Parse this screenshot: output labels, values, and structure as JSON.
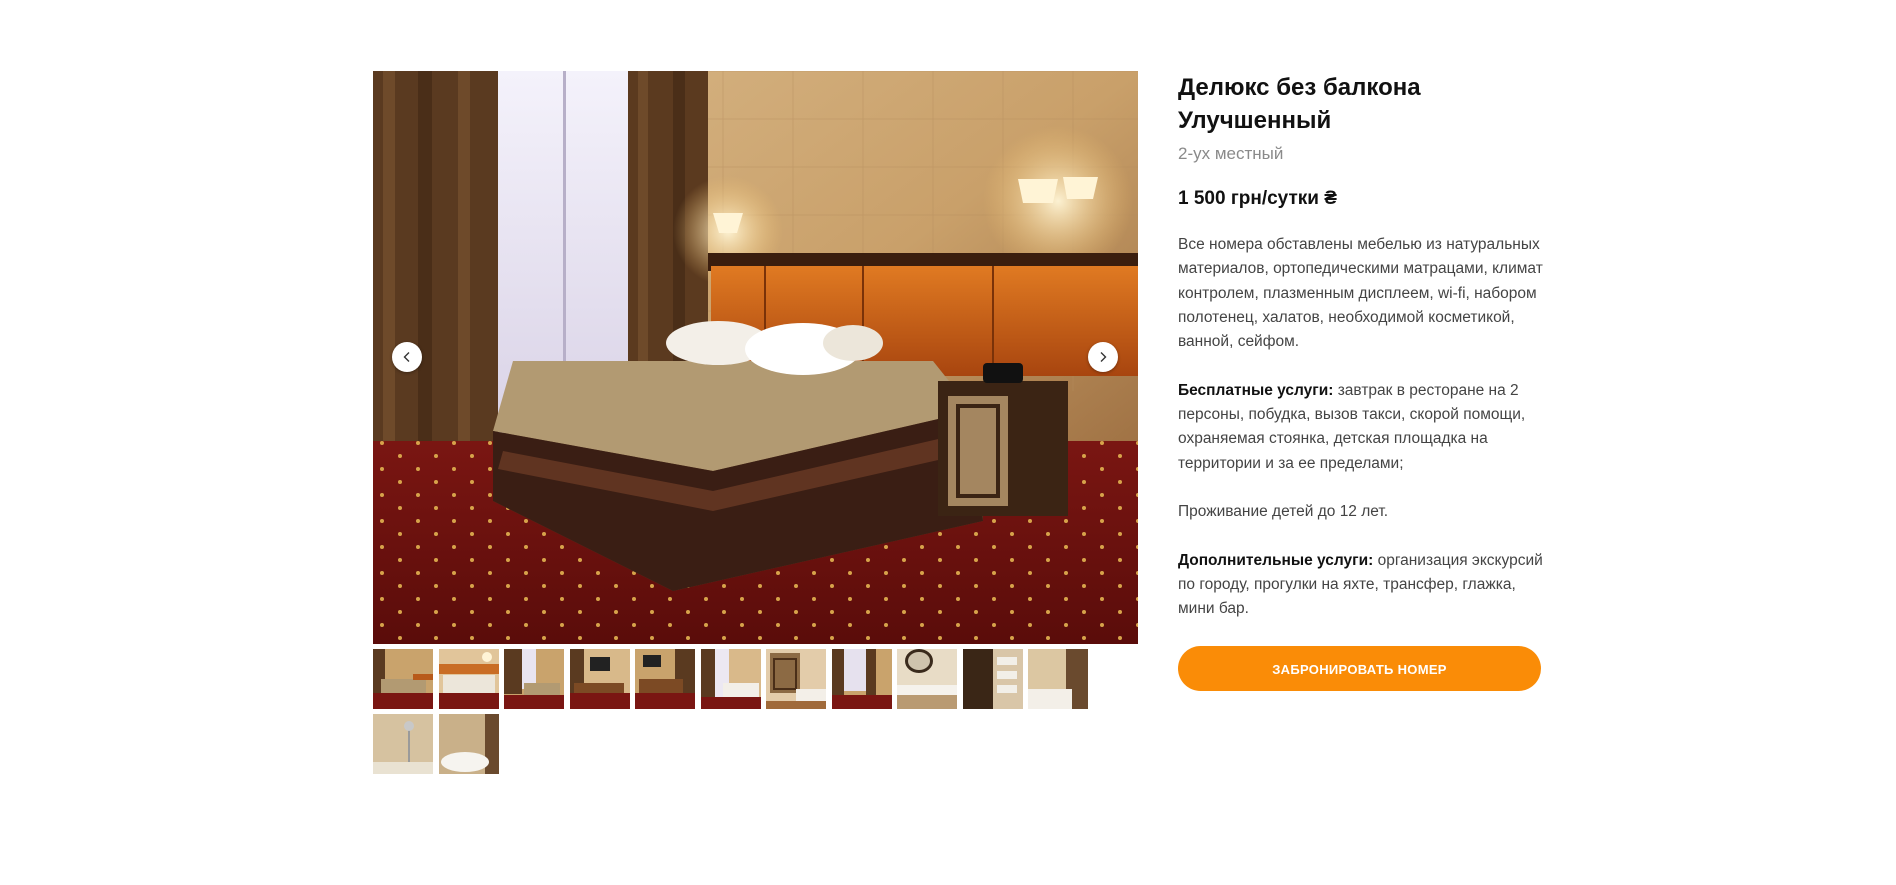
{
  "room": {
    "title_line1": "Делюкс без балкона",
    "title_line2": "Улучшенный",
    "capacity": "2-ух местный",
    "price": "1 500 грн/сутки ₴"
  },
  "description": {
    "amenities": "Все номера обставлены мебелью из натуральных материалов, ортопедическими матрацами, климат контролем, плазменным дисплеем, wi-fi, набором полотенец, халатов, необходимой косметикой, ванной, сейфом.",
    "free_label": "Бесплатные услуги:",
    "free_text": " завтрак в ресторане на 2 персоны, побудка, вызов такси, скорой помощи, охраняемая стоянка, детская площадка на территории и за ее пределами;",
    "children": "Проживание детей до 12 лет.",
    "extra_label": "Дополнительные услуги:",
    "extra_text": " организация экскурсий по городу, прогулки на яхте, трансфер, глажка, мини бар."
  },
  "actions": {
    "book_label": "ЗАБРОНИРОВАТЬ НОМЕР"
  },
  "gallery": {
    "prev_icon": "chevron-left-icon",
    "next_icon": "chevron-right-icon",
    "thumbnail_count": 13
  },
  "colors": {
    "accent": "#fa8c07",
    "text": "#111111",
    "muted": "#8a8a8a"
  }
}
